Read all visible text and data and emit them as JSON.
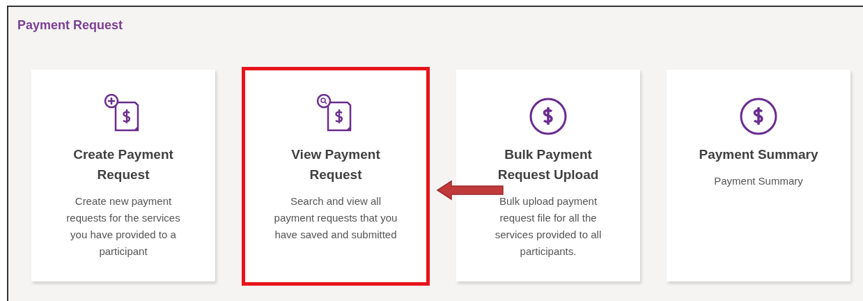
{
  "page": {
    "title": "Payment Request"
  },
  "cards": [
    {
      "kind": "document-plus",
      "title": "Create Payment Request",
      "description": "Create new payment requests for the services you have provided to a participant",
      "highlighted": false
    },
    {
      "kind": "document-search",
      "title": "View Payment Request",
      "description": "Search and view all payment requests that you have saved and submitted",
      "highlighted": true
    },
    {
      "kind": "dollar-circle",
      "title": "Bulk Payment Request Upload",
      "description": "Bulk upload payment request file for all the services provided to all participants.",
      "highlighted": false
    },
    {
      "kind": "dollar-circle",
      "title": "Payment Summary",
      "description": "Payment Summary",
      "highlighted": false
    }
  ]
}
